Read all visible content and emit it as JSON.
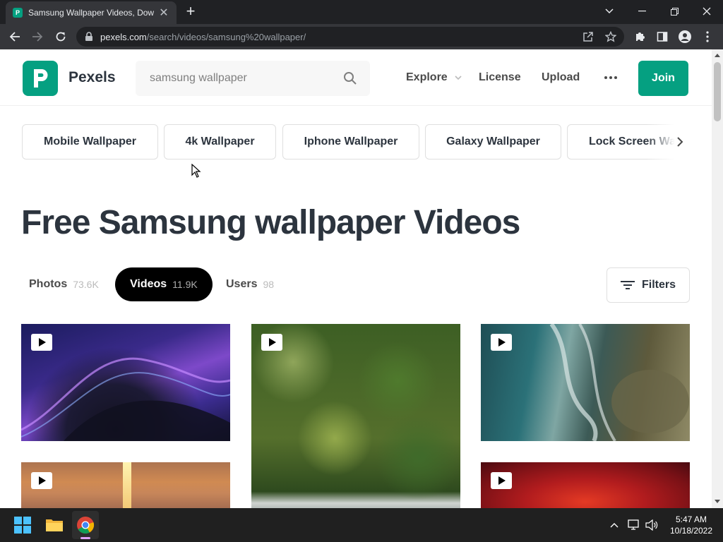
{
  "browser": {
    "tab_title": "Samsung Wallpaper Videos, Dow",
    "tab_favicon_letter": "P",
    "url_host": "pexels.com",
    "url_path": "/search/videos/samsung%20wallpaper/"
  },
  "site": {
    "brand": "Pexels",
    "search_value": "samsung wallpaper",
    "nav": {
      "explore": "Explore",
      "license": "License",
      "upload": "Upload"
    },
    "join_label": "Join"
  },
  "chips": [
    "Mobile Wallpaper",
    "4k Wallpaper",
    "Iphone Wallpaper",
    "Galaxy Wallpaper",
    "Lock Screen Wallpaper"
  ],
  "page_title": "Free Samsung wallpaper Videos",
  "media_tabs": [
    {
      "label": "Photos",
      "count": "73.6K",
      "active": false
    },
    {
      "label": "Videos",
      "count": "11.9K",
      "active": true
    },
    {
      "label": "Users",
      "count": "98",
      "active": false
    }
  ],
  "filters_label": "Filters",
  "thumbnails": [
    {
      "name": "purple-particle-wave-video",
      "scene": "purple particle wave"
    },
    {
      "name": "tropical-palm-forest-aerial-video",
      "scene": "aerial palm forest"
    },
    {
      "name": "ocean-rocky-coast-aerial-video",
      "scene": "ocean waves on rocks"
    },
    {
      "name": "sunset-sea-video",
      "scene": "sunset over sea"
    },
    {
      "name": "red-sky-video",
      "scene": "red sky"
    }
  ],
  "taskbar": {
    "time": "5:47 AM",
    "date": "10/18/2022"
  },
  "colors": {
    "brand_green": "#05a081",
    "text_dark": "#2c343e",
    "chrome_dark": "#202124",
    "chrome_toolbar": "#35363a",
    "taskbar": "#202020"
  }
}
